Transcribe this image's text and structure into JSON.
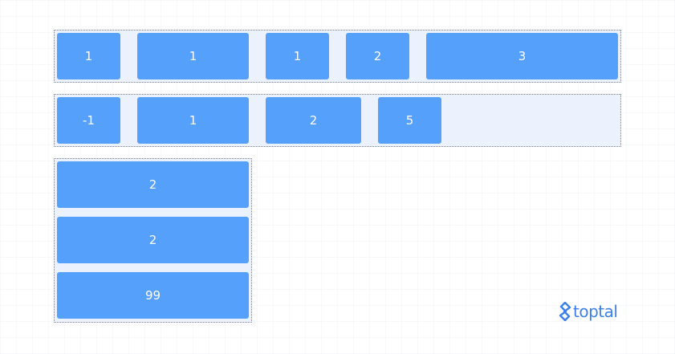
{
  "rows": {
    "row1": [
      "1",
      "1",
      "1",
      "2",
      "3"
    ],
    "row2": [
      "-1",
      "1",
      "2",
      "5"
    ]
  },
  "column": [
    "2",
    "2",
    "99"
  ],
  "logo": {
    "text": "toptal",
    "icon": "toptal-logo-icon",
    "color": "#3c80e8"
  },
  "colors": {
    "item": "#55a0fb",
    "container_fill": "#ebf2fd",
    "container_border": "#4a86e8",
    "item_text": "#ffffff"
  }
}
